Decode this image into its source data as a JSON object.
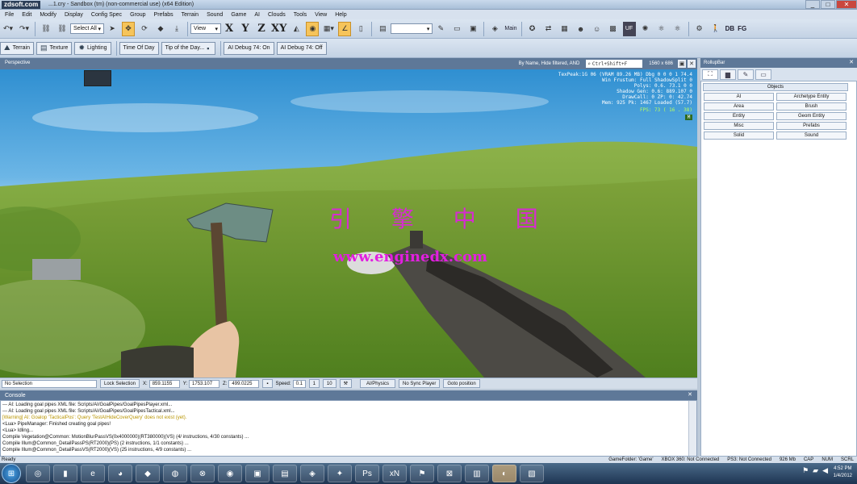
{
  "app": {
    "logo": "zdsoft.com",
    "title": "...1.cry - Sandbox (tm) (non-commercial use) (x64 Edition)"
  },
  "menu": [
    "File",
    "Edit",
    "Modify",
    "Display",
    "Config Spec",
    "Group",
    "Prefabs",
    "Terrain",
    "Sound",
    "Game",
    "AI",
    "Clouds",
    "Tools",
    "View",
    "Help"
  ],
  "toolbar1": {
    "select_all": "Select All",
    "view_combo": "View",
    "axis_x": "X",
    "axis_y": "Y",
    "axis_z": "Z",
    "axis_xy": "XY",
    "main_label": "Main",
    "db_label": "DB",
    "fg_label": "FG",
    "uf_label": "UF"
  },
  "toolbar2": {
    "terrain": "Terrain",
    "texture": "Texture",
    "lighting": "Lighting",
    "time_of_day": "Time Of Day",
    "tip_of_day": "Tip of the Day...",
    "ai_debug_on": "AI Debug 74: On",
    "ai_debug_off": "AI Debug 74: Off"
  },
  "viewport": {
    "name": "Perspective",
    "filter": "By Name, Hide filtered, AND",
    "search": "Ctrl+Shift+F",
    "resolution": "1560 x 686",
    "hud_lines": [
      "TexPeak:1G 06 (VRAM 89.26 MB) Dbg 0  0  0  1  74.4",
      "Win Frustum: Full ShadowSplit   0   ",
      "Polys: 0.6.  73.1   0   0",
      "Shadow Gen: 0.6: 889.107    0",
      "DrawCall: 0    ZP: 0: 42.74",
      "Mem: 925 Pk: 1467 Loaded (57.7)"
    ],
    "fps": "FPS: 73 (   16 .   38)",
    "mode_badge": "M",
    "watermark_cn": "引 擎 中 国",
    "watermark_url": "www.enginedx.com"
  },
  "status_row": {
    "selection": "No Selection",
    "lock": "Lock Selection",
    "x_label": "X:",
    "x_val": "859.1155",
    "y_label": "Y:",
    "y_val": "1753.107",
    "z_label": "Z:",
    "z_val": "499.0225",
    "speed_label": "Speed:",
    "speed_val": "0.1",
    "speed_1": "1",
    "speed_10": "10",
    "ai_physics": "AI/Physics",
    "no_sync": "No Sync Player",
    "goto": "Goto position"
  },
  "console": {
    "title": "Console",
    "lines": [
      "--- AI: Loading goal pipes XML file: Scripts/AI/GoalPipes/GoalPipesPlayer.xml...",
      "--- AI: Loading goal pipes XML file: Scripts/AI/GoalPipes/GoalPipesTactical.xml...",
      "[Warning] AI: Goalop 'TacticalPos': Query 'TestAIHideCoverQuery' does not exist (yet).",
      "<Lua> PipeManager: Finished creating goal pipes!",
      "<Lua> Idling...",
      "Compile Vegetation@Common: MotionBlurPassVS(0x4000000)(RT380000)(VS) (4/ instructions, 4/30 constants) ...",
      "Compile Illum@Common_DetailPassPS(RT2000)(PS) (2 instructions, 1/1 constants) ...",
      "Compile Illum@Common_DetailPassVS(RT2000)(VS) (25 instructions, 4/9 constants) ..."
    ]
  },
  "rollup": {
    "title": "RollupBar",
    "objects_title": "Objects",
    "buttons": [
      "AI",
      "Archetype Entity",
      "Area",
      "Brush",
      "Entity",
      "Geom Entity",
      "Misc",
      "Prefabs",
      "Solid",
      "Sound"
    ]
  },
  "statusbar": {
    "ready": "Ready",
    "game_folder": "GameFolder: 'Game'",
    "xbox": "XBOX 360: Not Connected",
    "ps3": "PS3: Not Connected",
    "mem": "926 Mb",
    "cap": "CAP",
    "num": "NUM",
    "scrl": "SCRL"
  },
  "taskbar": {
    "time": "4:52 PM",
    "date": "1/4/2012"
  },
  "colors": {
    "sky_top": "#2f8fd1",
    "grass": "#6f9a2e",
    "watermark": "#e21fe0",
    "panel_header": "#5e7898"
  }
}
